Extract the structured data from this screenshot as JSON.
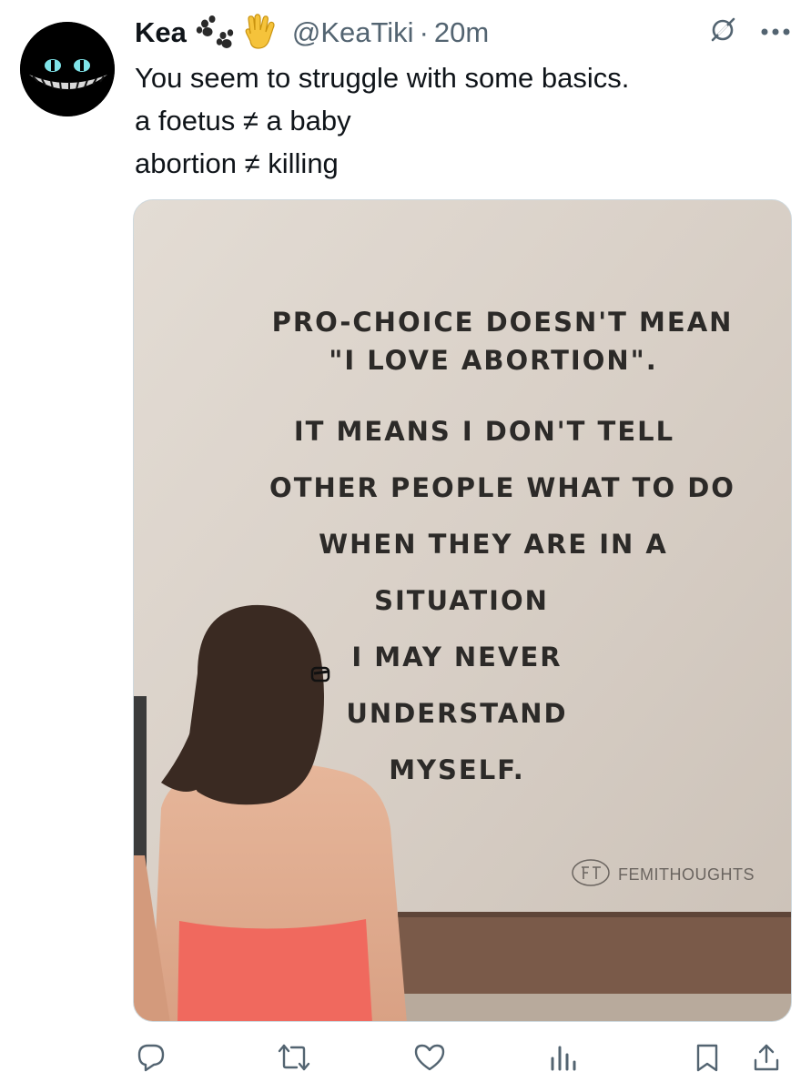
{
  "tweet": {
    "author": {
      "display_name": "Kea",
      "emoji": [
        "paw-prints-icon",
        "vulcan-salute-icon"
      ],
      "handle": "@KeaTiki",
      "separator": "·",
      "time": "20m"
    },
    "text_lines": [
      "You seem to struggle with some basics.",
      "a foetus ≠ a baby",
      "abortion ≠ killing"
    ],
    "top_icons": [
      "grok-icon",
      "more-icon"
    ],
    "media": {
      "wall_text_lines": [
        "Pro-Choice doesn't mean",
        "\"I Love Abortion\".",
        "It means I don't tell",
        "other people what to do",
        "when they are in a",
        "situation",
        "I may never",
        "understand",
        "myself."
      ],
      "watermark": "FEMITHOUGHTS"
    },
    "actions": [
      "reply-icon",
      "repost-icon",
      "like-icon",
      "views-icon",
      "bookmark-icon",
      "share-icon"
    ]
  }
}
